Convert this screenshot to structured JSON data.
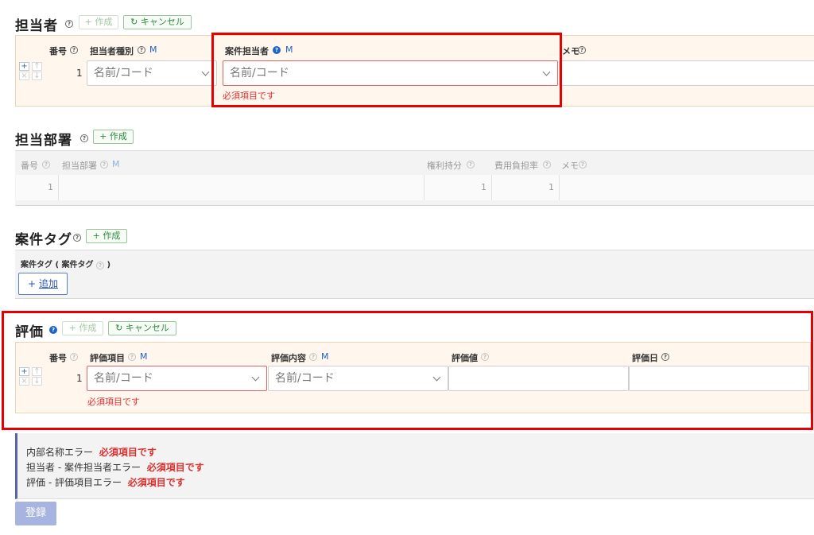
{
  "tantousha": {
    "title": "担当者",
    "create_label": "+ 作成",
    "cancel_label": "キャンセル",
    "headers": {
      "no": "番号",
      "type": "担当者種別",
      "person": "案件担当者",
      "memo": "メモ",
      "m": "M"
    },
    "row": {
      "no": "1",
      "type_placeholder": "名前/コード",
      "person_placeholder": "名前/コード",
      "error": "必須項目です"
    }
  },
  "busho": {
    "title": "担当部署",
    "create_label": "+ 作成",
    "headers": {
      "no": "番号",
      "dept": "担当部署",
      "rights": "権利持分",
      "cost": "費用負担率",
      "memo": "メモ",
      "m": "M"
    },
    "row": {
      "no": "1",
      "rights": "1",
      "cost": "1"
    }
  },
  "tag": {
    "title": "案件タグ",
    "create_label": "+ 作成",
    "label_prefix": "案件タグ ( 案件タグ",
    "label_suffix": ")",
    "add_label": "追加"
  },
  "hyouka": {
    "title": "評価",
    "create_label": "+ 作成",
    "cancel_label": "キャンセル",
    "headers": {
      "no": "番号",
      "item": "評価項目",
      "content": "評価内容",
      "value": "評価値",
      "date": "評価日",
      "m": "M"
    },
    "row": {
      "no": "1",
      "item_placeholder": "名前/コード",
      "content_placeholder": "名前/コード",
      "error": "必須項目です"
    }
  },
  "errors": [
    {
      "prefix": "内部名称エラー",
      "message": "必須項目です"
    },
    {
      "prefix": "担当者 - 案件担当者エラー",
      "message": "必須項目です"
    },
    {
      "prefix": "評価 - 評価項目エラー",
      "message": "必須項目です"
    }
  ],
  "submit_label": "登録",
  "colors": {
    "accent": "#1e63c8",
    "error": "#d9312f",
    "highlight": "#e60000",
    "submit": "#a8b4e0"
  }
}
